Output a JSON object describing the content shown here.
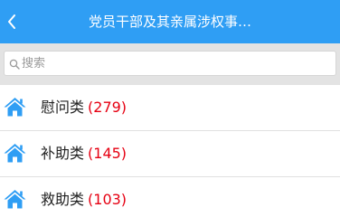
{
  "colors": {
    "navbar_bg": "#2f9ef4",
    "search_area_bg": "#e3e3e3",
    "count_color": "#e60012",
    "icon_color": "#2f9ef4"
  },
  "header": {
    "back_icon": "chevron-left-icon",
    "title": "党员干部及其亲属涉权事…"
  },
  "search": {
    "icon": "search-icon",
    "placeholder": "搜索",
    "value": ""
  },
  "list": {
    "icon": "home-icon",
    "items": [
      {
        "label": "慰问类",
        "count": "(279)"
      },
      {
        "label": "补助类",
        "count": "(145)"
      },
      {
        "label": "救助类",
        "count": "(103)"
      }
    ]
  }
}
